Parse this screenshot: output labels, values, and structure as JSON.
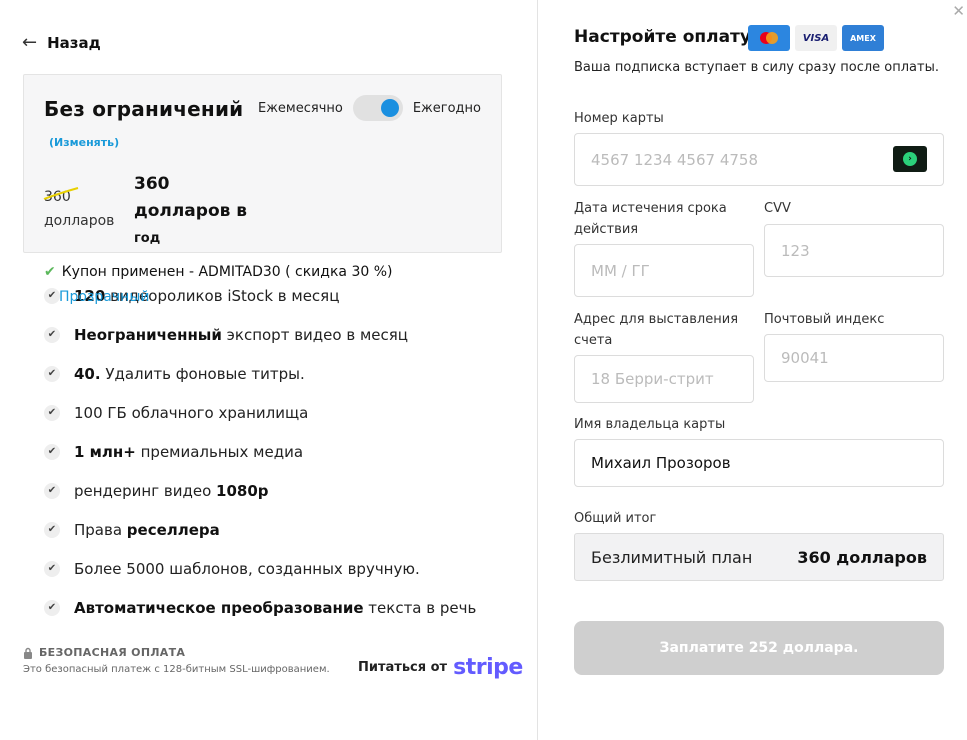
{
  "nav": {
    "back_label": "Назад",
    "close_icon": "close-icon"
  },
  "plan": {
    "title": "Без ограничений",
    "billing_monthly": "Ежемесячно",
    "billing_yearly": "Ежегодно",
    "billing_selected": "Ежегодно",
    "change_label": "(Изменять)",
    "old_price_num": "360",
    "old_price_unit": "долларов",
    "new_price_line1": "360",
    "new_price_line2": "долларов в",
    "new_price_unit": "год"
  },
  "coupon": {
    "text": "Купон применен  - ADMITAD30 ( скидка 30 %)",
    "sub": "Прозрачный"
  },
  "features": [
    {
      "bold": "120",
      "text": " видеороликов iStock в месяц"
    },
    {
      "bold": "Неограниченный",
      "text": " экспорт видео в месяц"
    },
    {
      "bold": "40.",
      "text": " Удалить фоновые титры."
    },
    {
      "bold": "",
      "text": "100 ГБ облачного хранилища"
    },
    {
      "bold": "1 млн+",
      "text": " премиальных медиа"
    },
    {
      "pre": "рендеринг видео ",
      "bold": "1080p",
      "text": ""
    },
    {
      "pre": "Права ",
      "bold": "реселлера",
      "text": ""
    },
    {
      "bold": "",
      "text": "Более 5000 шаблонов, созданных вручную."
    },
    {
      "bold": "Автоматическое преобразование",
      "text": " текста в речь"
    }
  ],
  "security": {
    "title": "БЕЗОПАСНАЯ ОПЛАТА",
    "subtitle": "Это безопасный платеж с 128-битным SSL-шифрованием.",
    "powered_by": "Питаться от",
    "stripe": "stripe"
  },
  "payment": {
    "title": "Настройте оплату",
    "card_logos": [
      "mastercard",
      "VISA",
      "AMEX"
    ],
    "subtitle": "Ваша подписка вступает в силу сразу после оплаты.",
    "card_number_label": "Номер карты",
    "card_number_placeholder": "4567 1234 4567 4758",
    "expiry_label": "Дата истечения срока действия",
    "expiry_placeholder": "ММ / ГГ",
    "cvv_label": "CVV",
    "cvv_placeholder": "123",
    "address_label": "Адрес для выставления счета",
    "address_placeholder": "18 Берри-стрит",
    "zip_label": "Почтовый индекс",
    "zip_placeholder": "90041",
    "name_label": "Имя владельца карты",
    "name_value": "Михаил Прозоров",
    "total_label": "Общий итог",
    "total_plan": "Безлимитный план",
    "total_amount": "360 долларов",
    "pay_button": "Заплатите 252 доллара."
  },
  "colors": {
    "accent": "#1a8fe0",
    "link": "#1a9ad9",
    "stripe": "#635bff",
    "pay_disabled": "#cfcfcf"
  }
}
